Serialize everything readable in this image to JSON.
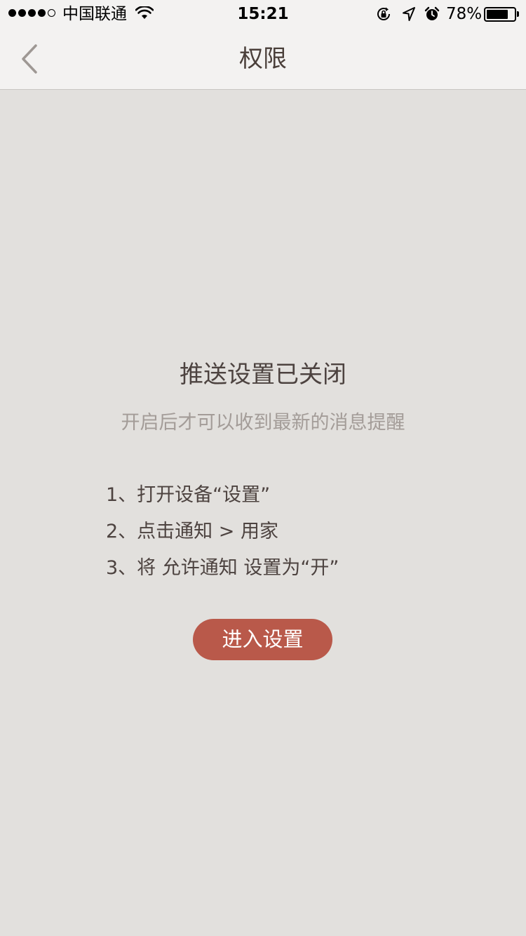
{
  "status_bar": {
    "carrier": "中国联通",
    "time": "15:21",
    "battery_percent": "78%",
    "battery_level": 0.78,
    "signal_bars_filled": 4,
    "signal_bars_total": 5,
    "icons": [
      "wifi-icon",
      "rotation-lock-icon",
      "location-arrow-icon",
      "alarm-clock-icon",
      "battery-icon"
    ]
  },
  "nav": {
    "title": "权限",
    "back_icon": "chevron-left-icon"
  },
  "main": {
    "heading": "推送设置已关闭",
    "subheading": "开启后才可以收到最新的消息提醒",
    "steps": [
      "1、打开设备“设置”",
      "2、点击通知 > 用家",
      "3、将 允许通知 设置为“开”"
    ],
    "button_label": "进入设置"
  },
  "colors": {
    "background": "#e2e0dd",
    "nav_background": "#f3f2f1",
    "text_primary": "#4d4340",
    "text_secondary": "#a39c98",
    "accent_button": "#b9594a"
  }
}
